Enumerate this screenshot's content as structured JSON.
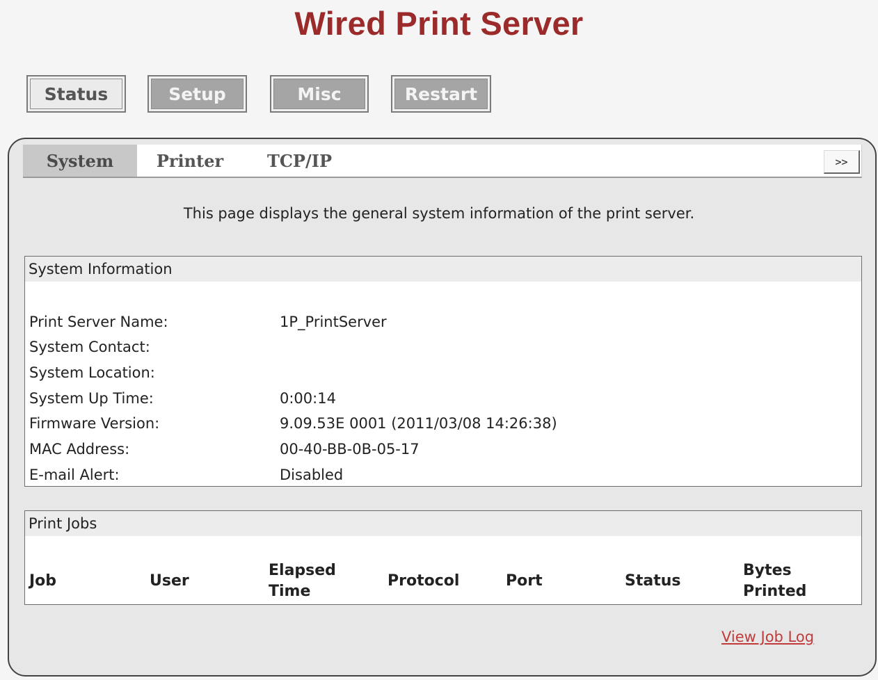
{
  "app": {
    "title": "Wired Print Server"
  },
  "main_nav": [
    {
      "label": "Status",
      "state": "active"
    },
    {
      "label": "Setup",
      "state": "inactive"
    },
    {
      "label": "Misc",
      "state": "inactive"
    },
    {
      "label": "Restart",
      "state": "inactive"
    }
  ],
  "sub_nav": {
    "tabs": [
      {
        "label": "System",
        "state": "active"
      },
      {
        "label": "Printer",
        "state": "inactive"
      },
      {
        "label": "TCP/IP",
        "state": "inactive"
      }
    ],
    "more_label": ">>"
  },
  "description": "This page displays the general system information of the print server.",
  "system_info": {
    "header": "System Information",
    "rows": [
      {
        "label": "Print Server Name:",
        "value": "1P_PrintServer"
      },
      {
        "label": "System Contact:",
        "value": ""
      },
      {
        "label": "System Location:",
        "value": ""
      },
      {
        "label": "System Up Time:",
        "value": "0:00:14"
      },
      {
        "label": "Firmware Version:",
        "value": "9.09.53E 0001 (2011/03/08 14:26:38)"
      },
      {
        "label": "MAC Address:",
        "value": "00-40-BB-0B-05-17"
      },
      {
        "label": "E-mail Alert:",
        "value": "Disabled"
      }
    ]
  },
  "print_jobs": {
    "header": "Print Jobs",
    "columns": [
      {
        "line1": "Job",
        "line2": ""
      },
      {
        "line1": "User",
        "line2": ""
      },
      {
        "line1": "Elapsed",
        "line2": "Time"
      },
      {
        "line1": "Protocol",
        "line2": ""
      },
      {
        "line1": "Port",
        "line2": ""
      },
      {
        "line1": "Status",
        "line2": ""
      },
      {
        "line1": "Bytes",
        "line2": "Printed"
      }
    ],
    "rows": []
  },
  "links": {
    "view_job_log": "View Job Log"
  },
  "colors": {
    "title": "#9b2a2a",
    "link": "#c23a3a",
    "panel_background": "#e7e7e7",
    "inactive_button": "#a5a5a5"
  }
}
